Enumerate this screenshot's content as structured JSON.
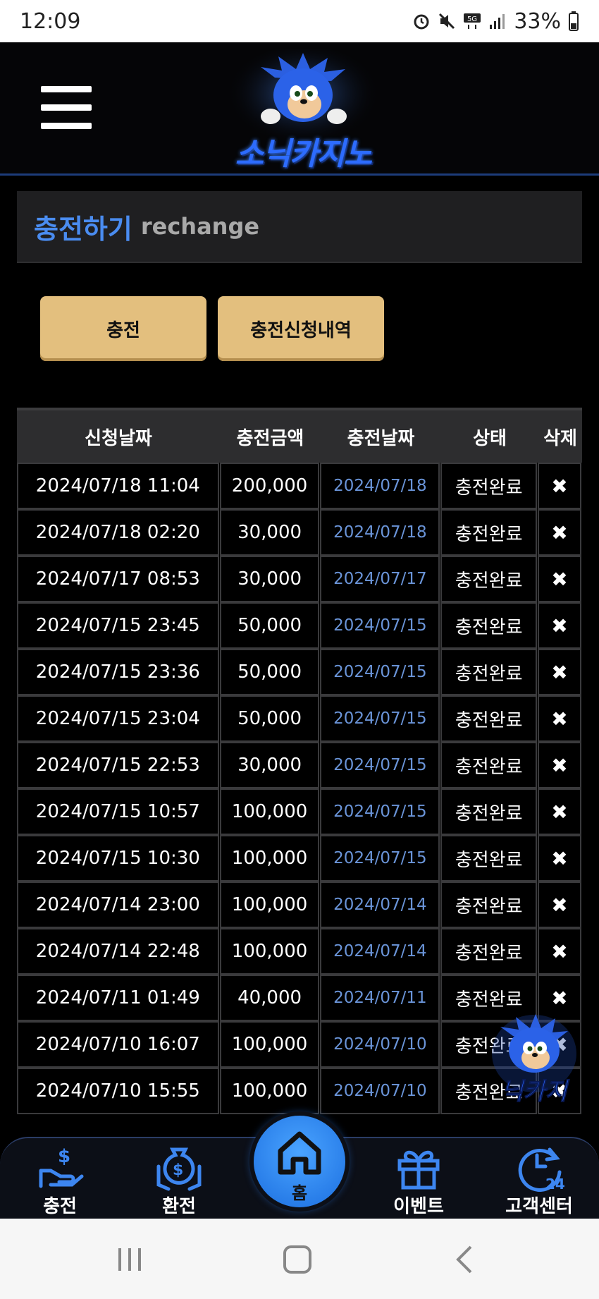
{
  "status": {
    "time": "12:09",
    "battery": "33%"
  },
  "header": {
    "logo_text": "소닉카지노"
  },
  "page": {
    "title_ko": "충전하기",
    "title_en": "rechange"
  },
  "buttons": {
    "charge": "충전",
    "history": "충전신청내역"
  },
  "table": {
    "headers": [
      "신청날짜",
      "충전금액",
      "충전날짜",
      "상태",
      "삭제"
    ],
    "delete_icon": "✖",
    "rows": [
      {
        "req": "2024/07/18 11:04",
        "amount": "200,000",
        "date": "2024/07/18",
        "status": "충전완료"
      },
      {
        "req": "2024/07/18 02:20",
        "amount": "30,000",
        "date": "2024/07/18",
        "status": "충전완료"
      },
      {
        "req": "2024/07/17 08:53",
        "amount": "30,000",
        "date": "2024/07/17",
        "status": "충전완료"
      },
      {
        "req": "2024/07/15 23:45",
        "amount": "50,000",
        "date": "2024/07/15",
        "status": "충전완료"
      },
      {
        "req": "2024/07/15 23:36",
        "amount": "50,000",
        "date": "2024/07/15",
        "status": "충전완료"
      },
      {
        "req": "2024/07/15 23:04",
        "amount": "50,000",
        "date": "2024/07/15",
        "status": "충전완료"
      },
      {
        "req": "2024/07/15 22:53",
        "amount": "30,000",
        "date": "2024/07/15",
        "status": "충전완료"
      },
      {
        "req": "2024/07/15 10:57",
        "amount": "100,000",
        "date": "2024/07/15",
        "status": "충전완료"
      },
      {
        "req": "2024/07/15 10:30",
        "amount": "100,000",
        "date": "2024/07/15",
        "status": "충전완료"
      },
      {
        "req": "2024/07/14 23:00",
        "amount": "100,000",
        "date": "2024/07/14",
        "status": "충전완료"
      },
      {
        "req": "2024/07/14 22:48",
        "amount": "100,000",
        "date": "2024/07/14",
        "status": "충전완료"
      },
      {
        "req": "2024/07/11 01:49",
        "amount": "40,000",
        "date": "2024/07/11",
        "status": "충전완료"
      },
      {
        "req": "2024/07/10 16:07",
        "amount": "100,000",
        "date": "2024/07/10",
        "status": "충전완료"
      },
      {
        "req": "2024/07/10 15:55",
        "amount": "100,000",
        "date": "2024/07/10",
        "status": "충전완료"
      }
    ]
  },
  "bottom_nav": {
    "charge": "충전",
    "exchange": "환전",
    "home": "홈",
    "event": "이벤트",
    "support": "고객센터",
    "support_badge": "24"
  },
  "colors": {
    "accent_blue": "#4a8cf0",
    "button_gold": "#e3bf7e",
    "date_blue": "#6a94d8"
  }
}
